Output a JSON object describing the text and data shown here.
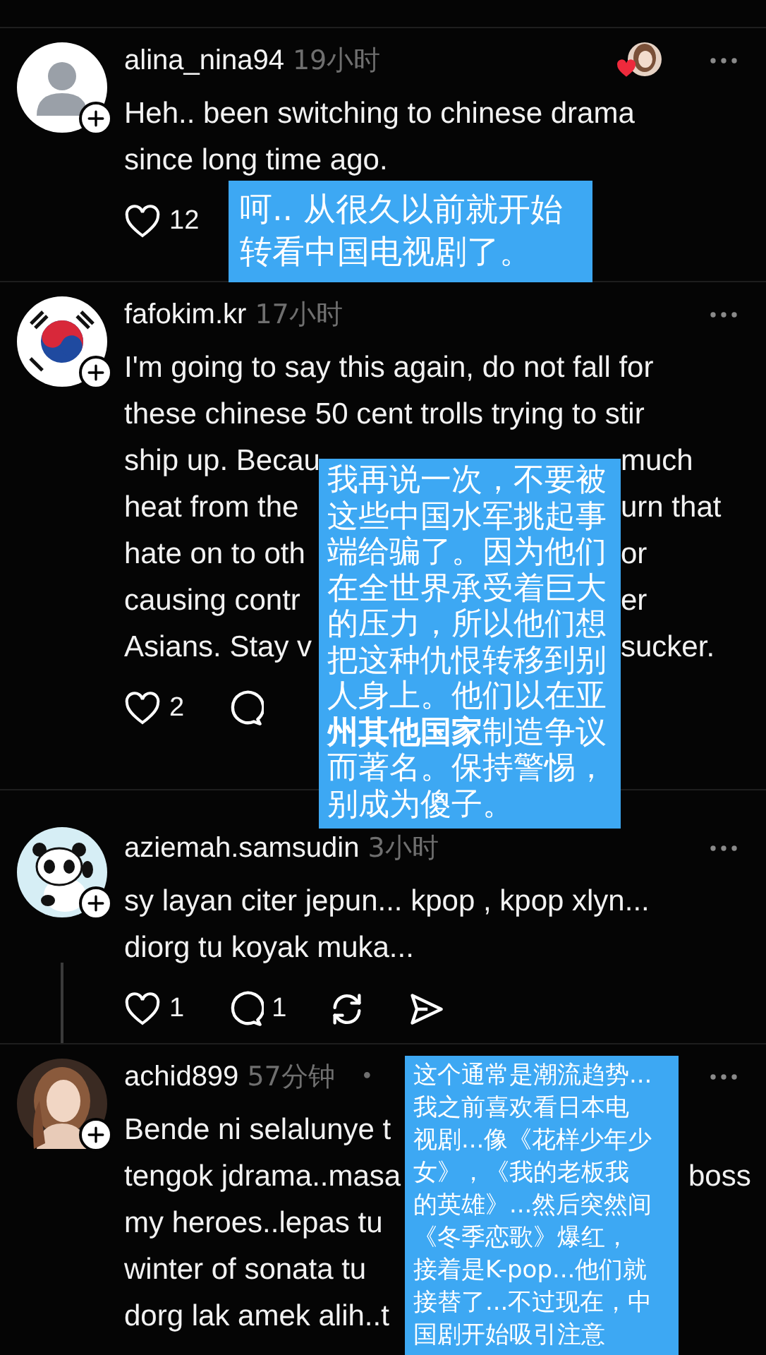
{
  "comments": [
    {
      "avatar": {
        "kind": "default"
      },
      "username": "alina_nina94",
      "time": "19小时",
      "liked_by_author": true,
      "lines": [
        {
          "left": "Heh.. been switching to chinese drama"
        },
        {
          "left": "since long time ago."
        }
      ],
      "actions": [
        {
          "kind": "like",
          "count": "12"
        }
      ],
      "overlay": {
        "lines": [
          "呵.. 从很久以前就开始",
          "转看中国电视剧了。"
        ]
      }
    },
    {
      "avatar": {
        "kind": "flag"
      },
      "username": "fafokim.kr",
      "time": "17小时",
      "lines": [
        {
          "left": "I'm going to say this again, do not fall for"
        },
        {
          "left": "these chinese 50 cent trolls trying to stir"
        },
        {
          "left": "ship up. Becau",
          "right": "much"
        },
        {
          "left": "heat from the",
          "right": "urn that"
        },
        {
          "left": "hate on to oth",
          "right": "or"
        },
        {
          "left": "causing contr",
          "right": "er"
        },
        {
          "left": "Asians. Stay v",
          "right": "sucker."
        }
      ],
      "actions": [
        {
          "kind": "like",
          "count": "2"
        },
        {
          "kind": "reply"
        }
      ],
      "overlay": {
        "lines": [
          "我再说一次，不要被",
          "这些中国水军挑起事",
          "端给骗了。因为他们",
          "在全世界承受着巨大",
          "的压力，所以他们想",
          "把这种仇恨转移到别",
          "人身上。他们以在亚",
          "**州其他国家**制造争议",
          "而著名。保持警惕，",
          "别成为傻子。"
        ]
      }
    },
    {
      "avatar": {
        "kind": "panda"
      },
      "username": "aziemah.samsudin",
      "time": "3小时",
      "thread_line": true,
      "lines": [
        {
          "left": "sy layan citer jepun... kpop , kpop xlyn..."
        },
        {
          "left": "diorg tu koyak muka..."
        }
      ],
      "actions": [
        {
          "kind": "like",
          "count": "1"
        },
        {
          "kind": "reply",
          "count": "1"
        },
        {
          "kind": "repost"
        },
        {
          "kind": "share"
        }
      ]
    },
    {
      "username": "achid899",
      "time": "57分钟",
      "dot": "•",
      "lines": [
        {
          "left": "Bende ni selalunye t"
        },
        {
          "left": "tengok jdrama..masa",
          "right": "boss"
        },
        {
          "left": "my heroes..lepas tu"
        },
        {
          "left": "winter of sonata tu"
        },
        {
          "left": "dorg lak amek alih..t"
        }
      ],
      "overlay": {
        "lines": [
          "这个通常是潮流趋势...",
          "我之前喜欢看日本电",
          "视剧...像《花样少年少",
          "女》，《我的老板我",
          "的英雄》...然后突然间",
          "《冬季恋歌》爆红，",
          "接着是K-pop...他们就",
          "接替了...不过现在，中",
          "国剧开始吸引注意"
        ]
      }
    }
  ]
}
